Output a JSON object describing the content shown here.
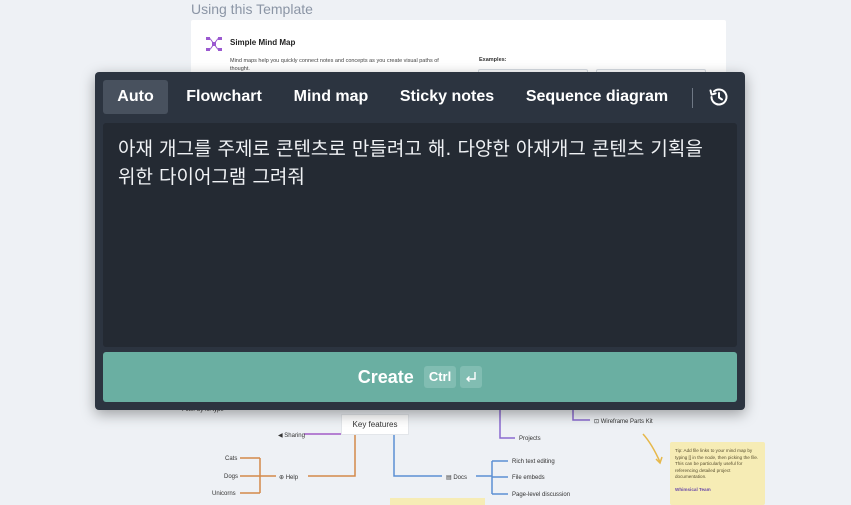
{
  "background": {
    "heading": "Using this Template",
    "card": {
      "title": "Simple Mind Map",
      "description": "Mind maps help you quickly connect notes and concepts as you create visual paths of thought.",
      "examples_label": "Examples:"
    },
    "mindmap": {
      "root": "Key features",
      "nodes": {
        "sharing": "Sharing",
        "help": "Help",
        "cats": "Cats",
        "dogs": "Dogs",
        "unicorns": "Unicorns",
        "docs": "Docs",
        "rich_text": "Rich text editing",
        "file_embeds": "File embeds",
        "page_level": "Page-level discussion",
        "projects": "Projects",
        "wireframe": "Wireframe Parts Kit",
        "filter": "Filter by fill type"
      }
    },
    "note": {
      "text": "Tip: Add file links to your mind map by typing [[ in the node, then picking the file. This can be particularly useful for referencing detailed project documentation.",
      "author": "Whimsical Team"
    }
  },
  "modal": {
    "tabs": [
      {
        "label": "Auto",
        "active": true
      },
      {
        "label": "Flowchart",
        "active": false
      },
      {
        "label": "Mind map",
        "active": false
      },
      {
        "label": "Sticky notes",
        "active": false
      },
      {
        "label": "Sequence diagram",
        "active": false
      }
    ],
    "history_icon": "history-icon",
    "prompt": {
      "value": "아재 개그를 주제로 콘텐츠로 만들려고 해. 다양한 아재개그 콘텐츠 기획을 위한 다이어그램 그려줘"
    },
    "create_button": {
      "label": "Create",
      "shortcut": "Ctrl",
      "enter_icon": "enter-icon"
    }
  },
  "colors": {
    "modal_bg": "#2c3440",
    "input_bg": "#242a33",
    "active_tab": "#48515e",
    "create_button": "#6aafa2",
    "canvas_bg": "#eef1f5",
    "accent_purple": "#9b59d0"
  }
}
